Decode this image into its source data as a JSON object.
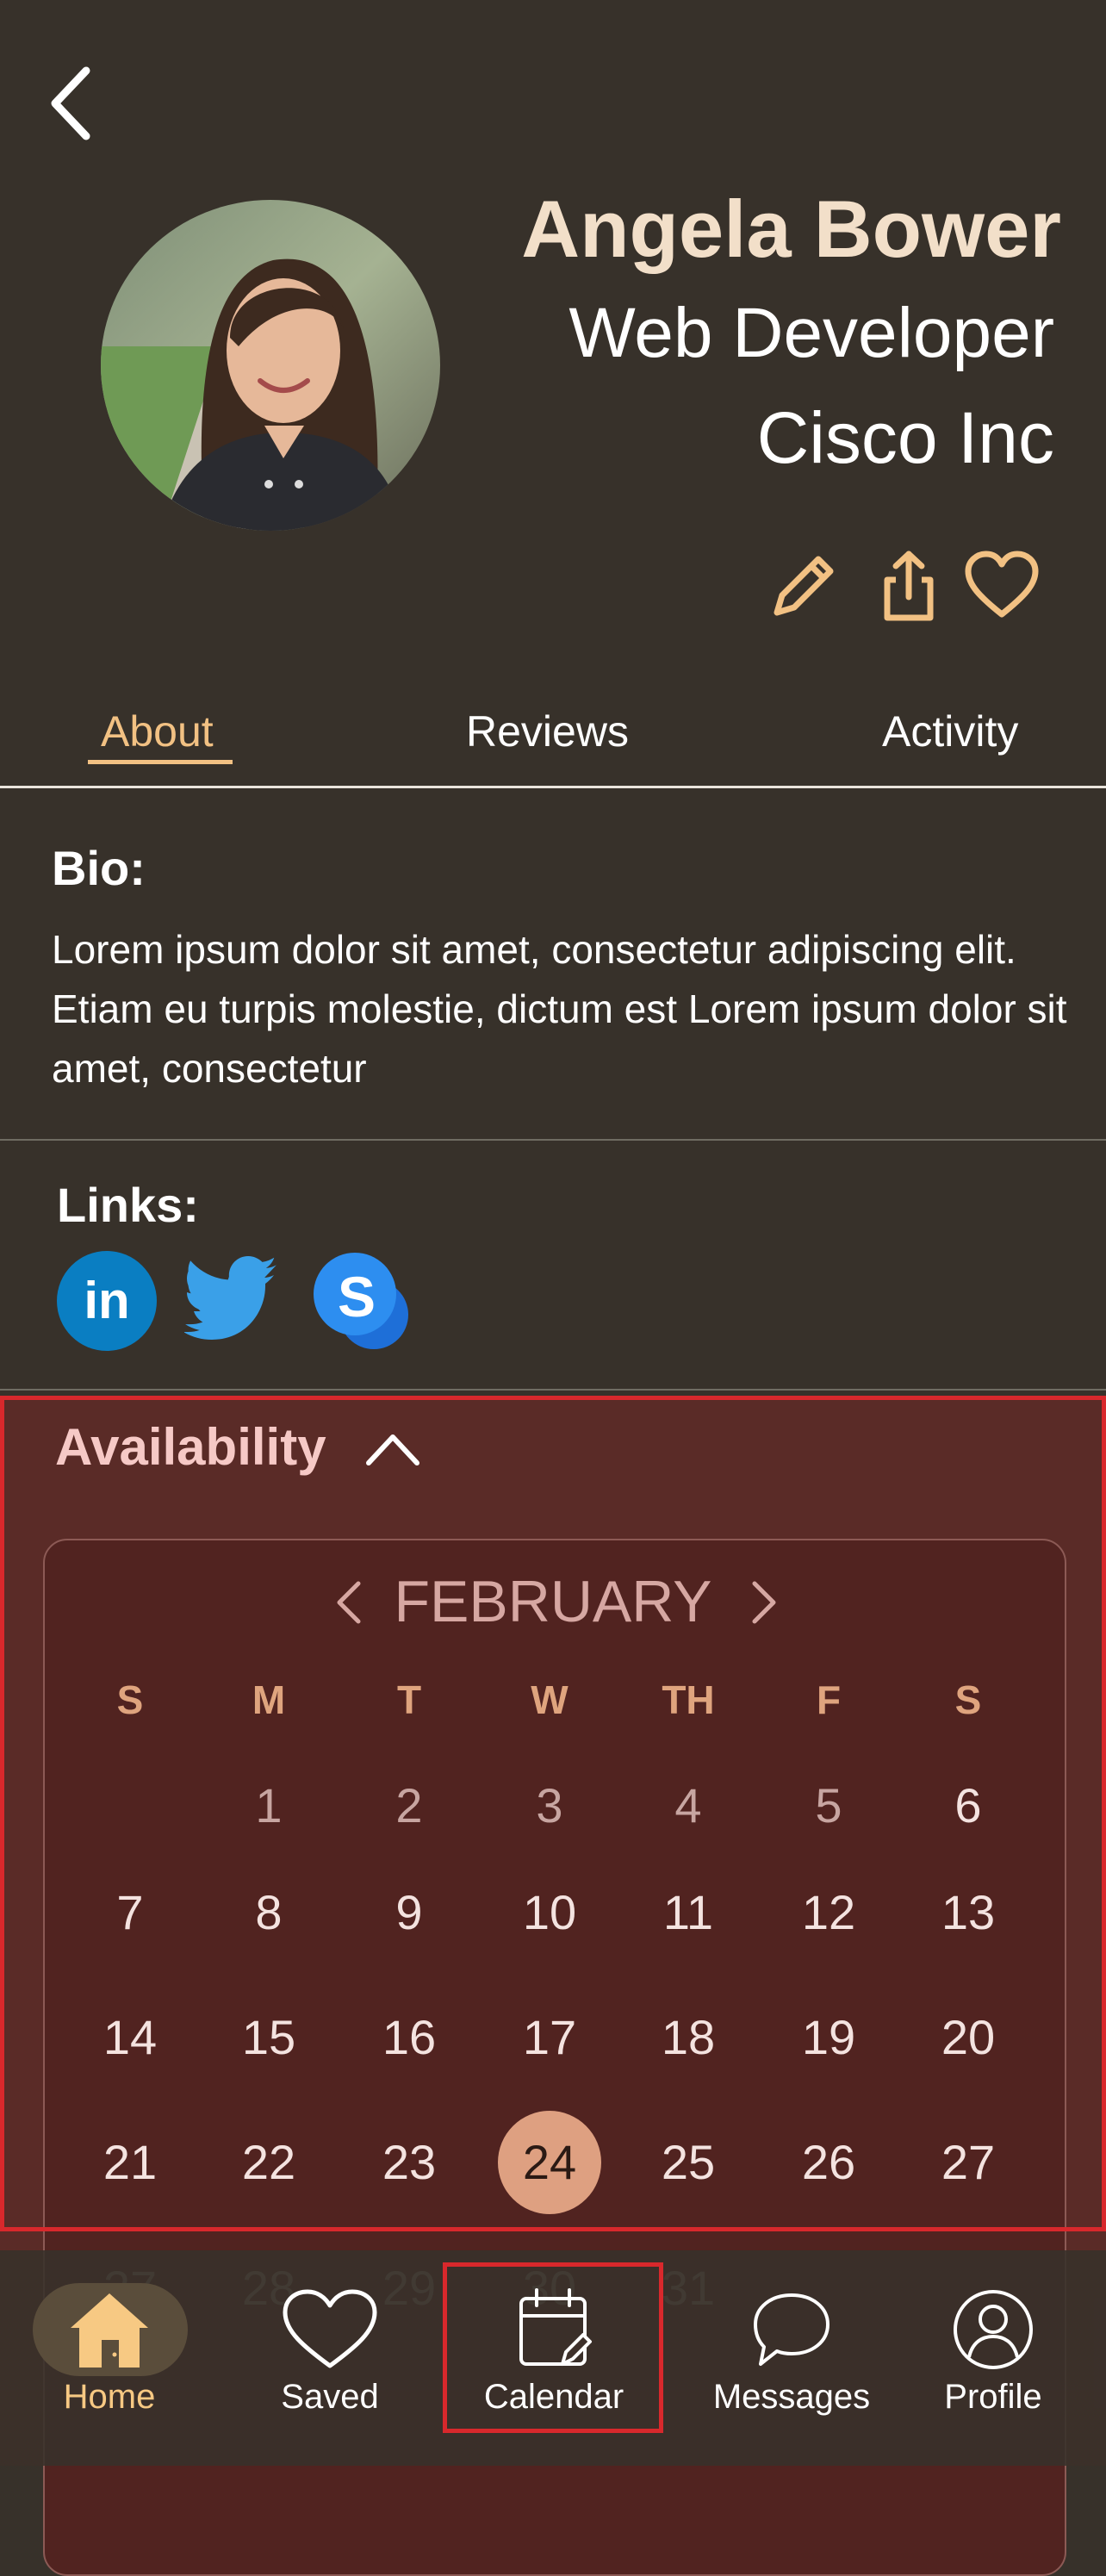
{
  "profile": {
    "name": "Angela Bower",
    "role": "Web Developer",
    "company": "Cisco Inc"
  },
  "actions": {
    "edit_icon": "pencil-icon",
    "share_icon": "share-icon",
    "favorite_icon": "heart-icon"
  },
  "tabs": [
    {
      "label": "About",
      "active": true
    },
    {
      "label": "Reviews",
      "active": false
    },
    {
      "label": "Activity",
      "active": false
    }
  ],
  "bio": {
    "title": "Bio:",
    "text": "Lorem ipsum dolor sit amet, consectetur adipiscing elit. Etiam eu turpis molestie, dictum est  Lorem ipsum dolor sit amet, consectetur"
  },
  "links": {
    "title": "Links:",
    "items": [
      {
        "name": "LinkedIn",
        "icon": "linkedin-icon",
        "glyph": "in"
      },
      {
        "name": "Twitter",
        "icon": "twitter-icon"
      },
      {
        "name": "Skype",
        "icon": "skype-icon",
        "glyph": "S"
      }
    ]
  },
  "availability": {
    "title": "Availability",
    "month": "FEBRUARY",
    "weekdays": [
      "S",
      "M",
      "T",
      "W",
      "TH",
      "F",
      "S"
    ],
    "weeks": [
      [
        "",
        "1",
        "2",
        "3",
        "4",
        "5",
        "6"
      ],
      [
        "7",
        "8",
        "9",
        "10",
        "11",
        "12",
        "13"
      ],
      [
        "14",
        "15",
        "16",
        "17",
        "18",
        "19",
        "20"
      ],
      [
        "21",
        "22",
        "23",
        "24",
        "25",
        "26",
        "27"
      ],
      [
        "27",
        "28",
        "29",
        "30",
        "31",
        "",
        ""
      ]
    ],
    "selected_day": "24"
  },
  "bottom_nav": [
    {
      "label": "Home",
      "icon": "home-icon",
      "active": true
    },
    {
      "label": "Saved",
      "icon": "heart-icon",
      "active": false
    },
    {
      "label": "Calendar",
      "icon": "calendar-icon",
      "active": false
    },
    {
      "label": "Messages",
      "icon": "chat-bubble-icon",
      "active": false
    },
    {
      "label": "Profile",
      "icon": "user-icon",
      "active": false
    }
  ],
  "colors": {
    "background": "#37312a",
    "accent": "#f2c183",
    "availability_panel": "#5a2b27",
    "selected_day": "#dea081",
    "highlight_box": "#d8282c"
  }
}
